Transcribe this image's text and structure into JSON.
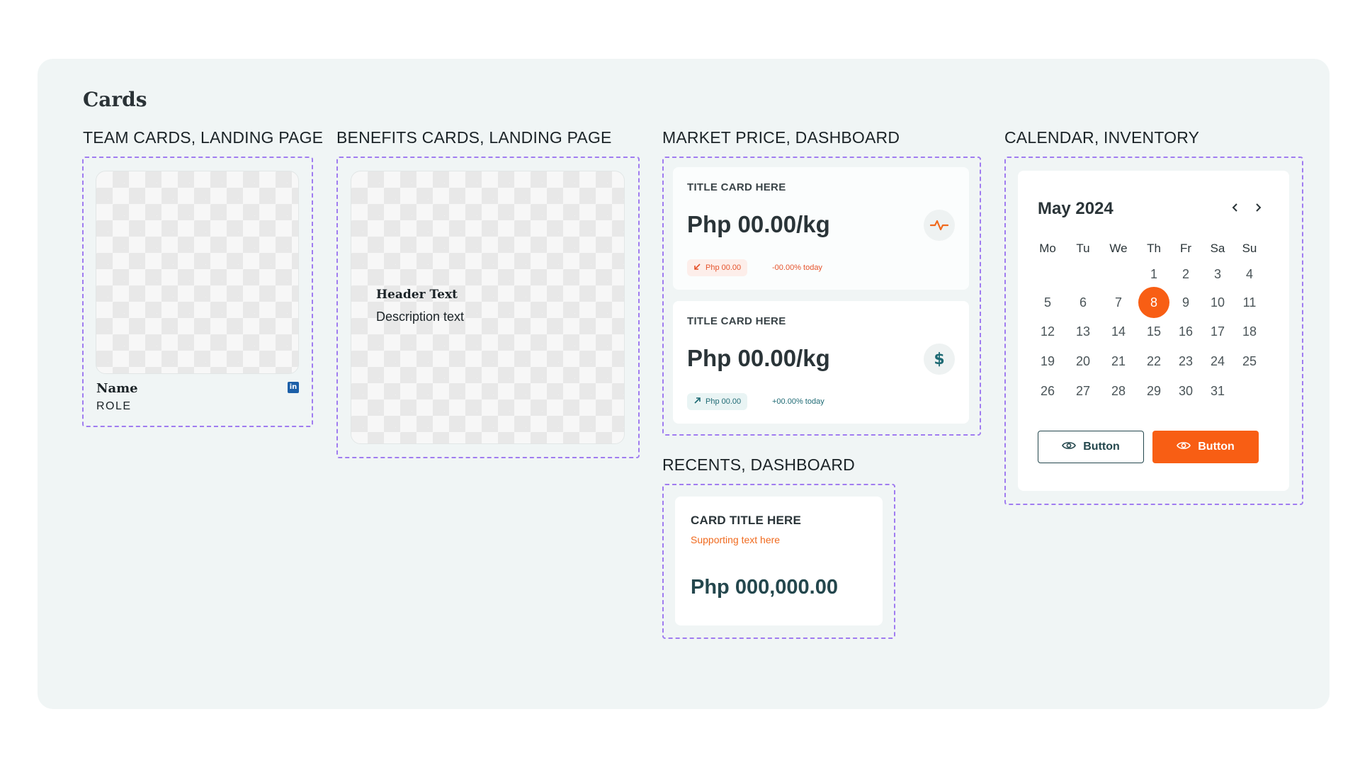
{
  "page": {
    "title": "Cards"
  },
  "sections": {
    "team": "TEAM CARDS, LANDING PAGE",
    "benefits": "BENEFITS CARDS, LANDING PAGE",
    "market": "MARKET PRICE, DASHBOARD",
    "calendar": "CALENDAR, INVENTORY",
    "recents": "RECENTS, DASHBOARD"
  },
  "team_card": {
    "name": "Name",
    "role": "ROLE",
    "social_icon": "linkedin-icon"
  },
  "benefit_card": {
    "header": "Header Text",
    "description": "Description text"
  },
  "market_cards": [
    {
      "title": "TITLE CARD HERE",
      "price": "Php 00.00/kg",
      "icon": "pulse-icon",
      "change_value": "Php 00.00",
      "change_pct": "-00.00% today",
      "trend": "down"
    },
    {
      "title": "TITLE CARD HERE",
      "price": "Php 00.00/kg",
      "icon": "dollar-icon",
      "change_value": "Php 00.00",
      "change_pct": "+00.00% today",
      "trend": "up"
    }
  ],
  "recents_card": {
    "title": "CARD TITLE HERE",
    "supporting": "Supporting text here",
    "amount": "Php 000,000.00"
  },
  "calendar": {
    "month": "May 2024",
    "weekdays": [
      "Mo",
      "Tu",
      "We",
      "Th",
      "Fr",
      "Sa",
      "Su"
    ],
    "selected_day": "8",
    "weeks": [
      [
        "",
        "",
        "",
        "1",
        "2",
        "3",
        "4"
      ],
      [
        "5",
        "6",
        "7",
        "8",
        "9",
        "10",
        "11"
      ],
      [
        "12",
        "13",
        "14",
        "15",
        "16",
        "17",
        "18"
      ],
      [
        "19",
        "20",
        "21",
        "22",
        "23",
        "24",
        "25"
      ],
      [
        "26",
        "27",
        "28",
        "29",
        "30",
        "31",
        ""
      ]
    ],
    "buttons": [
      {
        "label": "Button",
        "style": "outline",
        "icon": "eye-icon"
      },
      {
        "label": "Button",
        "style": "primary",
        "icon": "eye-icon"
      }
    ]
  },
  "colors": {
    "accent": "#f85e14",
    "teal": "#24474d",
    "dash": "#a07cf0",
    "panel": "#f0f5f5"
  }
}
